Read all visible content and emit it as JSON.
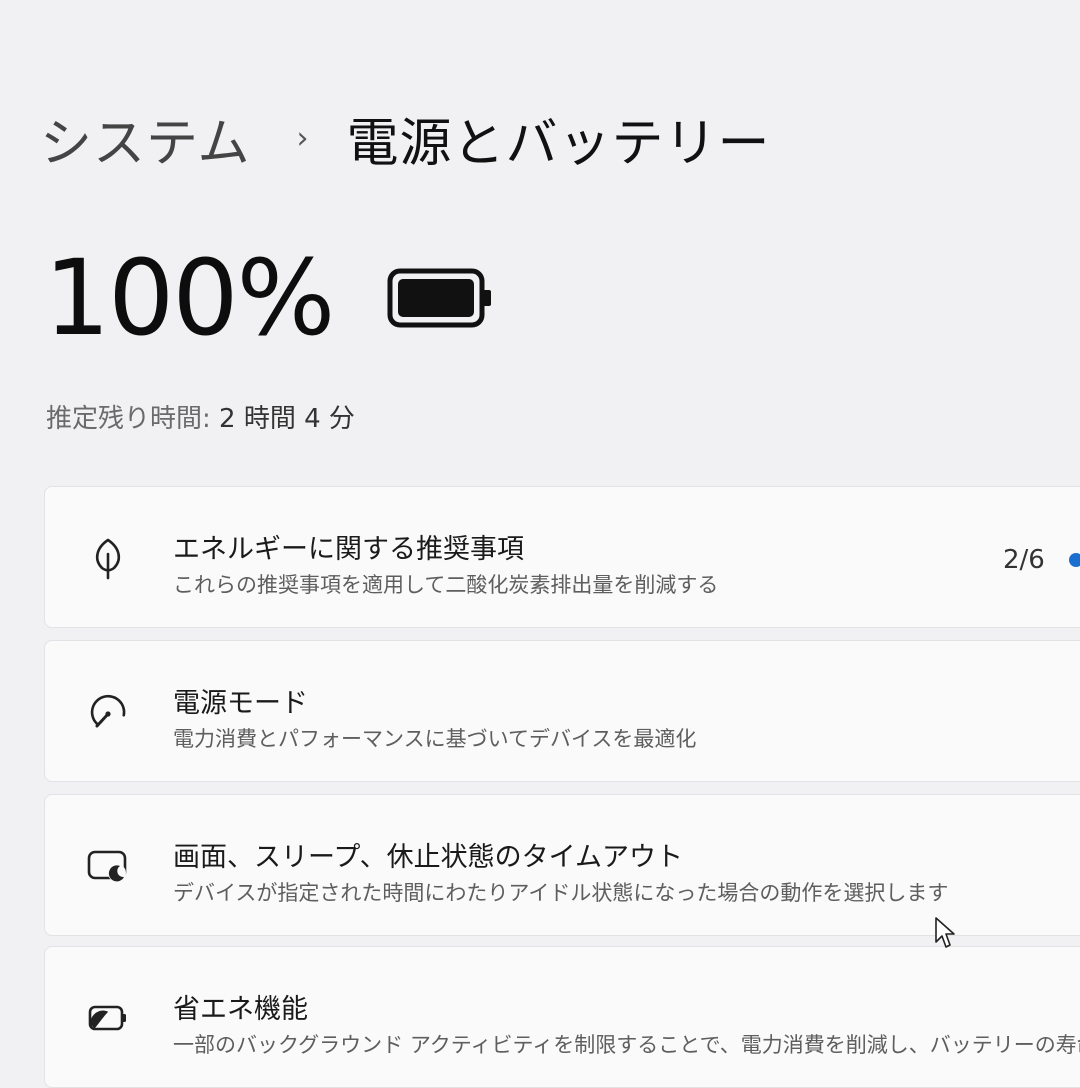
{
  "breadcrumb": {
    "parent": "システム",
    "separator": "›",
    "current": "電源とバッテリー"
  },
  "battery": {
    "percent_text": "100%",
    "level": 1.0,
    "icon": "battery-full-icon",
    "remaining_label": "推定残り時間:",
    "remaining_value": "2 時間 4 分"
  },
  "cards": [
    {
      "icon": "leaf-icon",
      "title": "エネルギーに関する推奨事項",
      "description": "これらの推奨事項を適用して二酸化炭素排出量を削減する",
      "count": "2/6"
    },
    {
      "icon": "power-mode-gauge-icon",
      "title": "電源モード",
      "description": "電力消費とパフォーマンスに基づいてデバイスを最適化"
    },
    {
      "icon": "screen-sleep-icon",
      "title": "画面、スリープ、休止状態のタイムアウト",
      "description": "デバイスが指定された時間にわたりアイドル状態になった場合の動作を選択します"
    },
    {
      "icon": "battery-saver-icon",
      "title": "省エネ機能",
      "description": "一部のバックグラウンド アクティビティを制限することで、電力消費を削減し、バッテリーの寿命"
    }
  ],
  "colors": {
    "background": "#f1f1f3",
    "card": "#fafafb",
    "accent": "#1a6fd1"
  }
}
